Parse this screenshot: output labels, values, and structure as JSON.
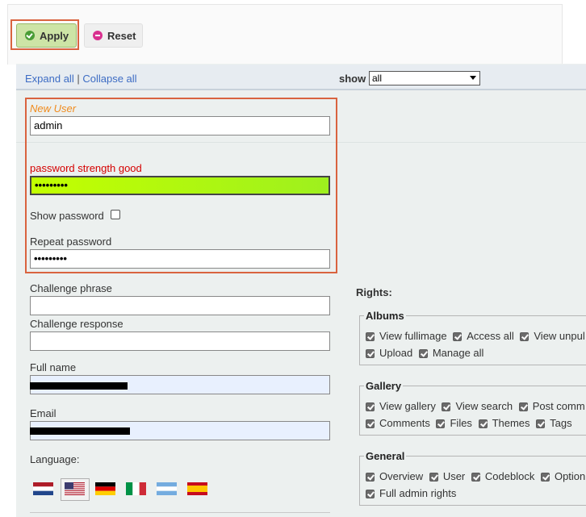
{
  "toolbar": {
    "apply_label": "Apply",
    "reset_label": "Reset"
  },
  "header": {
    "expand_all": "Expand all",
    "separator": "|",
    "collapse_all": "Collapse all",
    "show_label": "show",
    "show_value": "all"
  },
  "user": {
    "new_user_label": "New User",
    "username_value": "admin",
    "password_strength": "password strength good",
    "password_value": "•••••••••",
    "show_password_label": "Show password",
    "repeat_password_label": "Repeat password",
    "repeat_password_value": "•••••••••",
    "challenge_phrase_label": "Challenge phrase",
    "challenge_response_label": "Challenge response",
    "full_name_label": "Full name",
    "email_label": "Email",
    "language_label": "Language:"
  },
  "rights": {
    "label": "Rights:",
    "groups": [
      {
        "name": "Albums",
        "rows": [
          [
            "View fullimage",
            "Access all",
            "View unpul"
          ],
          [
            "Upload",
            "Manage all"
          ]
        ]
      },
      {
        "name": "Gallery",
        "rows": [
          [
            "View gallery",
            "View search",
            "Post comm"
          ],
          [
            "Comments",
            "Files",
            "Themes",
            "Tags"
          ]
        ]
      },
      {
        "name": "General",
        "rows": [
          [
            "Overview",
            "User",
            "Codeblock",
            "Option"
          ],
          [
            "Full admin rights"
          ]
        ]
      }
    ]
  },
  "languages": [
    "nl-flag",
    "us-flag",
    "de-flag",
    "it-flag",
    "ar-flag",
    "es-flag"
  ],
  "colors": {
    "accent_border": "#d9633f",
    "link": "#3d6cc4",
    "strength_good": "#c3ff00",
    "warning_text": "#d50000"
  }
}
